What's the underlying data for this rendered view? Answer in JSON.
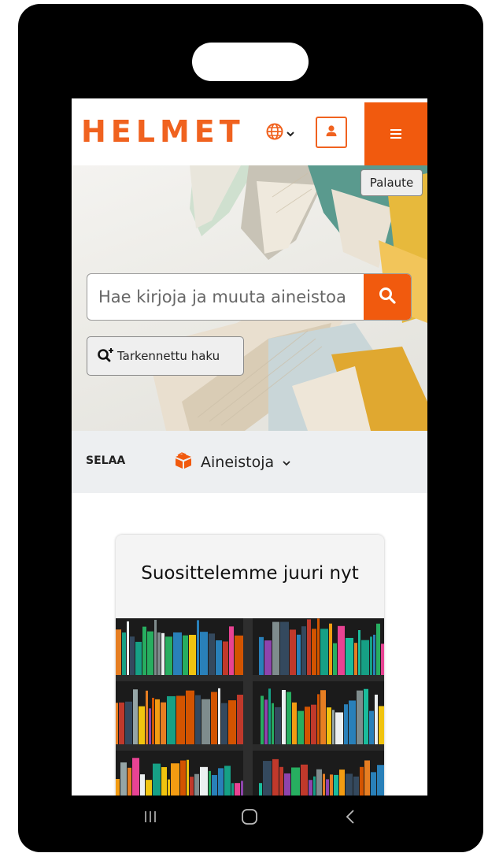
{
  "header": {
    "logo_text": "HELMET",
    "language_icon": "globe-icon",
    "user_icon": "user-icon",
    "menu_icon": "hamburger-menu-icon"
  },
  "hero": {
    "feedback_label": "Palaute",
    "search_placeholder": "Hae kirjoja ja muuta aineistoa",
    "search_icon": "search-icon",
    "advanced_search_label": "Tarkennettu haku",
    "advanced_search_icon": "search-plus-icon"
  },
  "browse": {
    "label": "SELAA",
    "dropdown_label": "Aineistoja",
    "dropdown_icon": "box-icon"
  },
  "recommendation": {
    "title": "Suosittelemme juuri nyt"
  },
  "system_nav": {
    "recents_icon": "recent-apps-icon",
    "home_icon": "home-icon",
    "back_icon": "back-icon"
  },
  "colors": {
    "brand_orange": "#f15a0e",
    "logo_orange": "#f0621f",
    "browse_bg": "#edeff1"
  }
}
